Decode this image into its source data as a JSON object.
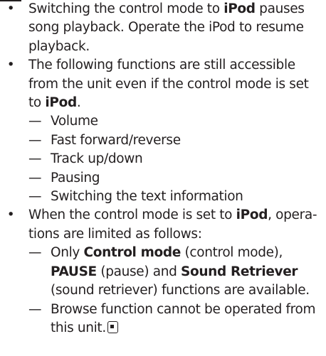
{
  "bullets": {
    "b1": {
      "prefix": "Switching the control mode to ",
      "bold": "iPod",
      "suffix": " pauses song playback. Operate the iPod to resume playback."
    },
    "b2": {
      "prefix": "The following functions are still accessible from the unit even if the control mode is set to ",
      "bold": "iPod",
      "suffix": ".",
      "subitems": [
        "Volume",
        "Fast forward/reverse",
        "Track up/down",
        "Pausing",
        "Switching the text information"
      ]
    },
    "b3": {
      "prefix": "When the control mode is set to ",
      "bold": "iPod",
      "suffix": ", opera-tions are limited as follows:",
      "sub1": {
        "t1": "Only ",
        "b1": "Control mode",
        "t2": " (control mode), ",
        "b2": "PAUSE",
        "t3": " (pause) and ",
        "b3": "Sound Retriever",
        "t4": " (sound retriever) functions are available."
      },
      "sub2": {
        "text": "Browse function cannot be operated from this unit."
      }
    }
  },
  "glyphs": {
    "bullet": "•",
    "dash": "—"
  },
  "icons": {
    "end_mark": "end-of-section-icon"
  }
}
